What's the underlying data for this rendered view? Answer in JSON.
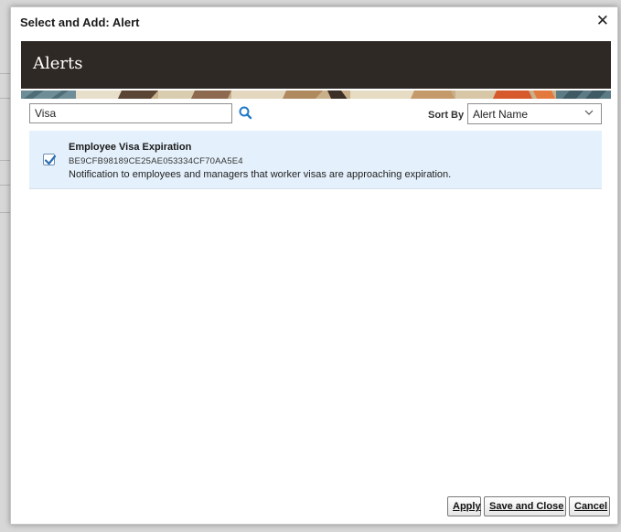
{
  "dialog": {
    "title": "Select and Add: Alert",
    "close_glyph": "✕"
  },
  "banner": {
    "title": "Alerts"
  },
  "search": {
    "value": "Visa",
    "icon": "search-icon"
  },
  "sort": {
    "label": "Sort By",
    "selected": "Alert Name"
  },
  "results": [
    {
      "name": "Employee Visa Expiration",
      "id": "BE9CFB98189CE25AE053334CF70AA5E4",
      "description": "Notification to employees and managers that worker visas are approaching expiration.",
      "checked": true
    }
  ],
  "buttons": {
    "apply": "Apply",
    "save_close": "Save and Close",
    "cancel": "Cancel"
  },
  "colors": {
    "banner_bg": "#2e2925",
    "selected_row_bg": "#e4f0fb",
    "checkbox_check": "#2b6fb5",
    "search_icon": "#1f78c8"
  }
}
